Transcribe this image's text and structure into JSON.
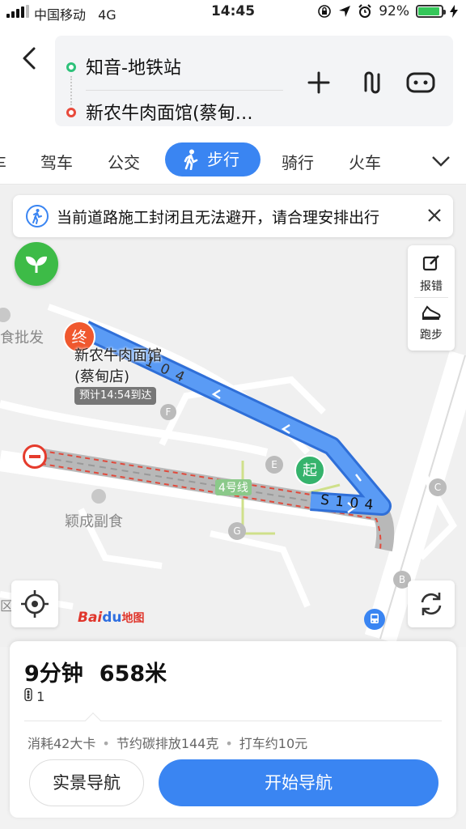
{
  "status_bar": {
    "carrier": "中国移动",
    "network": "4G",
    "time": "14:45",
    "battery": "92%",
    "battery_level": 0.92
  },
  "route": {
    "origin": "知音-地铁站",
    "destination": "新农牛肉面馆(蔡甸…"
  },
  "tabs": {
    "partial": "车",
    "drive": "驾车",
    "transit": "公交",
    "walk": "步行",
    "bike": "骑行",
    "train": "火车"
  },
  "notice": {
    "text": "当前道路施工封闭且无法避开，请合理安排出行"
  },
  "tools": {
    "report": "报错",
    "run": "跑步"
  },
  "map": {
    "poi_food_wholesale": "食批发",
    "poi_yingcheng": "颖成副食",
    "end_marker": "终",
    "end_name_line1": "新农牛肉面馆",
    "end_name_line2": "(蔡甸店)",
    "eta": "预计14:54到达",
    "start_marker": "起",
    "line4": "4号线",
    "road_s104_a": "S 1 0 4",
    "road_s104_b": "1 0 4",
    "exit_f": "F",
    "exit_e": "E",
    "exit_g": "G",
    "exit_c": "C",
    "exit_b": "B",
    "exit_a": "区"
  },
  "logo": {
    "text_bai": "Bai",
    "text_du": "du",
    "text_zh": "地图"
  },
  "summary": {
    "duration": "9分钟",
    "distance": "658米",
    "traffic_lights": "1",
    "calories": "消耗42大卡",
    "carbon": "节约碳排放144克",
    "taxi": "打车约10元"
  },
  "buttons": {
    "ar_nav": "实景导航",
    "start_nav": "开始导航"
  },
  "colors": {
    "accent": "#3a85f2",
    "route": "#4a8ff0",
    "closed": "#e53b2c",
    "start": "#35b36c",
    "end": "#f0582e"
  }
}
